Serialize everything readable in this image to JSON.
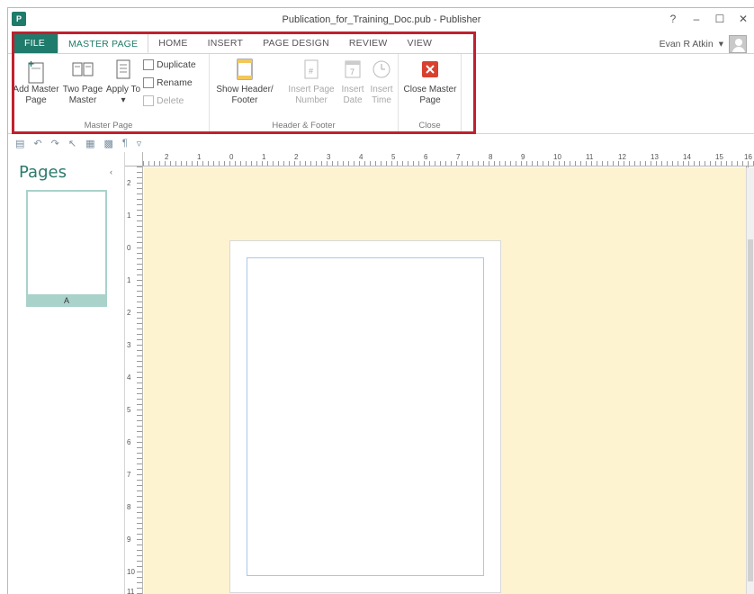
{
  "window": {
    "title": "Publication_for_Training_Doc.pub - Publisher",
    "app_icon": "P",
    "help": "?",
    "minimize": "–",
    "maximize": "☐",
    "close": "✕"
  },
  "tabs": [
    {
      "label": "FILE"
    },
    {
      "label": "MASTER PAGE"
    },
    {
      "label": "HOME"
    },
    {
      "label": "INSERT"
    },
    {
      "label": "PAGE DESIGN"
    },
    {
      "label": "REVIEW"
    },
    {
      "label": "VIEW"
    }
  ],
  "user": {
    "name": "Evan R Atkin",
    "dropdown": "▾"
  },
  "ribbon": {
    "master_page_group": {
      "label": "Master Page",
      "add_master_page": "Add Master Page",
      "two_page_master": "Two Page Master",
      "apply_to": "Apply To",
      "apply_to_arrow": "▾",
      "duplicate": "Duplicate",
      "rename": "Rename",
      "delete": "Delete"
    },
    "header_footer_group": {
      "label": "Header & Footer",
      "show_header_footer": "Show Header/ Footer",
      "insert_page_number": "Insert Page Number",
      "insert_date": "Insert Date",
      "insert_time": "Insert Time"
    },
    "close_group": {
      "label": "Close",
      "close_master_page": "Close Master Page"
    },
    "collapse_arrow": "^"
  },
  "pages_pane": {
    "title": "Pages",
    "collapse_arrow": "‹",
    "thumbnails": [
      {
        "label": "A"
      }
    ]
  },
  "ruler": {
    "top_numbers": [
      "2",
      "1",
      "0",
      "1",
      "2",
      "3",
      "4",
      "5",
      "6",
      "7",
      "8",
      "9",
      "10",
      "11",
      "12",
      "13",
      "14",
      "15",
      "16"
    ],
    "left_numbers": [
      "2",
      "1",
      "0",
      "1",
      "2",
      "3",
      "4",
      "5",
      "6",
      "7",
      "8",
      "9",
      "10",
      "11"
    ]
  },
  "colors": {
    "accent": "#1f7b6b",
    "workspace": "#fdf3d0",
    "highlight": "#c0202e",
    "close_button": "#d9402f"
  }
}
